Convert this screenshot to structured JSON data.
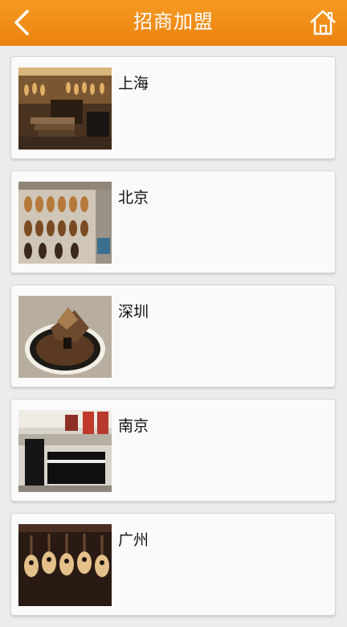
{
  "header": {
    "title": "招商加盟",
    "back_icon": "chevron-left-icon",
    "home_icon": "home-icon",
    "bg_color": "#f08a14"
  },
  "stores": [
    {
      "city": "上海",
      "image": "guitar-store-interior-photo"
    },
    {
      "city": "北京",
      "image": "guitar-wall-display-photo"
    },
    {
      "city": "深圳",
      "image": "piano-sculpture-photo"
    },
    {
      "city": "南京",
      "image": "piano-showroom-photo"
    },
    {
      "city": "广州",
      "image": "acoustic-guitars-photo"
    }
  ]
}
